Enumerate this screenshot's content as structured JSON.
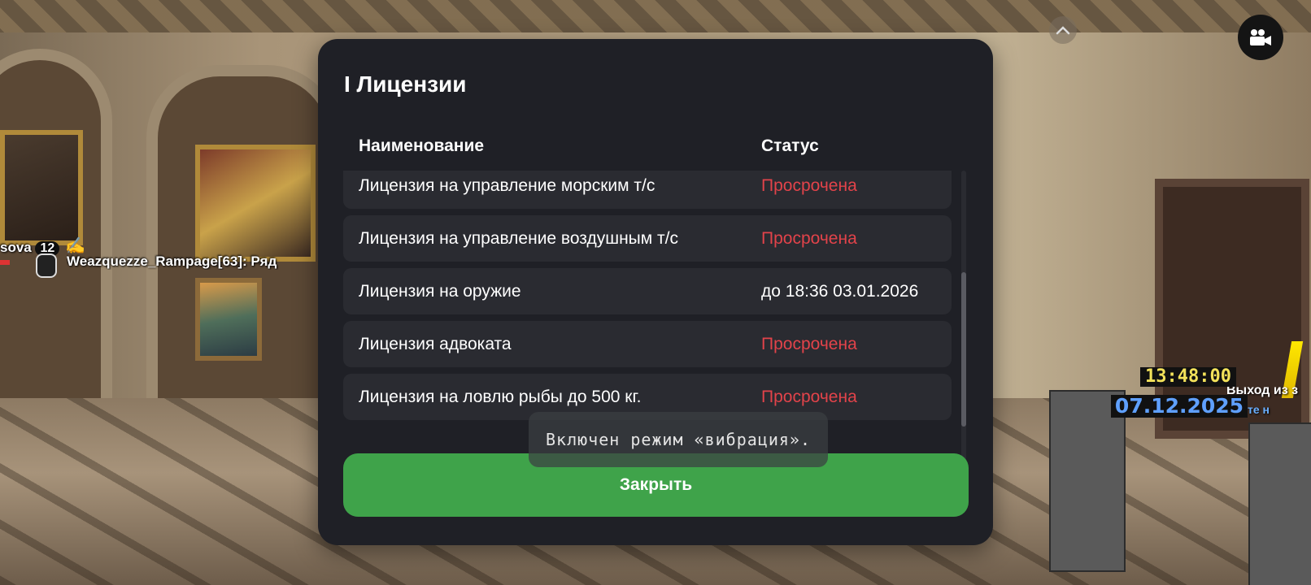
{
  "hud": {
    "player_partial_name": "sova",
    "player_id_badge": "12",
    "chat_line": "Weazquezze_Rampage[63]: Ряд",
    "time": "13:48:00",
    "date": "07.12.2025",
    "exit_text": "Выход из з",
    "exit_subtext": "те н"
  },
  "modal": {
    "title": "I Лицензии",
    "columns": {
      "name": "Наименование",
      "status": "Статус"
    },
    "rows": [
      {
        "name": "Лицензия на управление морским т/с",
        "status": "Просрочена",
        "expired": true
      },
      {
        "name": "Лицензия на управление воздушным т/с",
        "status": "Просрочена",
        "expired": true
      },
      {
        "name": "Лицензия на оружие",
        "status": "до 18:36 03.01.2026",
        "expired": false
      },
      {
        "name": "Лицензия адвоката",
        "status": "Просрочена",
        "expired": true
      },
      {
        "name": "Лицензия на ловлю рыбы до 500 кг.",
        "status": "Просрочена",
        "expired": true
      }
    ],
    "close_label": "Закрыть"
  },
  "toast": {
    "text": "Включен режим «вибрация»."
  },
  "colors": {
    "modal_bg": "#1f2026",
    "row_bg": "#2a2b31",
    "expired": "#e2434a",
    "close_button": "#3fa34a",
    "hud_time": "#f3e25a",
    "hud_date": "#5fa0ff"
  },
  "icons": {
    "top_button": "chevron-up-icon",
    "camera_button": "video-camera-icon",
    "voice": "microphone-icon"
  }
}
